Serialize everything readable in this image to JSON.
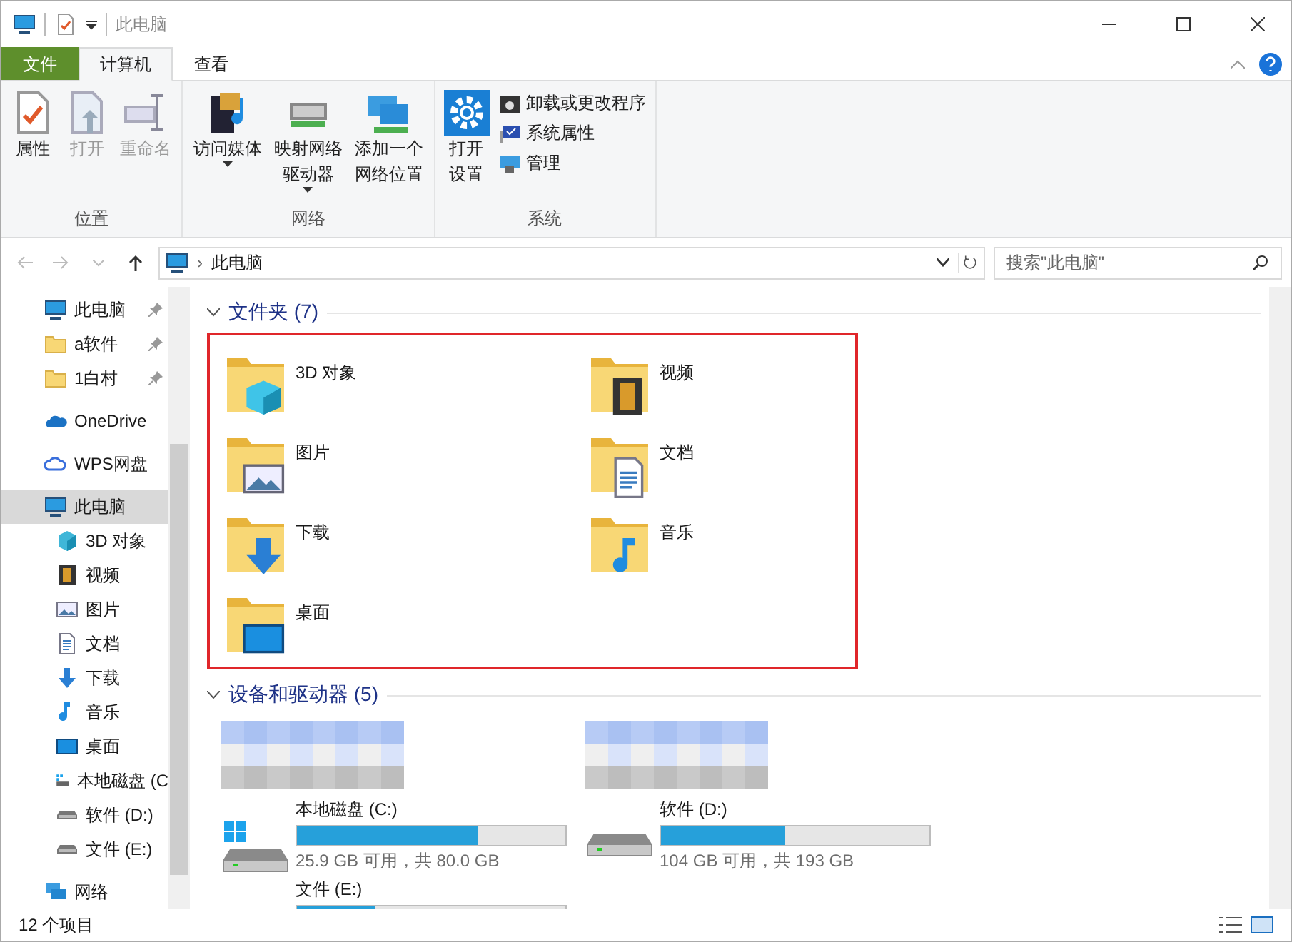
{
  "window": {
    "title": "此电脑"
  },
  "ribbon_tabs": [
    {
      "label": "文件",
      "kind": "file",
      "selected": false
    },
    {
      "label": "计算机",
      "kind": "tab",
      "selected": true
    },
    {
      "label": "查看",
      "kind": "tab",
      "selected": false
    }
  ],
  "ribbon_groups": [
    {
      "label": "位置",
      "items": [
        {
          "label": "属性",
          "disabled": false
        },
        {
          "label": "打开",
          "disabled": true
        },
        {
          "label": "重命名",
          "disabled": true
        }
      ]
    },
    {
      "label": "网络",
      "items": [
        {
          "label": "访问媒体",
          "disabled": false,
          "dropdown": true
        },
        {
          "label": "映射网络驱动器",
          "disabled": false,
          "dropdown": true
        },
        {
          "label": "添加一个网络位置",
          "disabled": false,
          "dropdown": false
        }
      ]
    },
    {
      "label": "系统",
      "items": [
        {
          "label": "打开设置",
          "disabled": false
        }
      ],
      "small_items": [
        {
          "label": "卸载或更改程序"
        },
        {
          "label": "系统属性"
        },
        {
          "label": "管理"
        }
      ]
    }
  ],
  "address": {
    "separator": "›",
    "path": "此电脑",
    "search_placeholder": "搜索\"此电脑\""
  },
  "sidebar": [
    {
      "label": "此电脑",
      "pinned": true,
      "selected": false
    },
    {
      "label": "a软件",
      "pinned": true,
      "selected": false
    },
    {
      "label": "1白村",
      "pinned": true,
      "selected": false
    },
    {
      "label": "OneDrive",
      "pinned": false,
      "selected": false
    },
    {
      "label": "WPS网盘",
      "pinned": false,
      "selected": false
    },
    {
      "label": "此电脑",
      "pinned": false,
      "selected": true,
      "children": [
        {
          "label": "3D 对象",
          "pinned": false,
          "selected": false
        },
        {
          "label": "视频",
          "pinned": false,
          "selected": false
        },
        {
          "label": "图片",
          "pinned": false,
          "selected": false
        },
        {
          "label": "文档",
          "pinned": false,
          "selected": false
        },
        {
          "label": "下载",
          "pinned": false,
          "selected": false
        },
        {
          "label": "音乐",
          "pinned": false,
          "selected": false
        },
        {
          "label": "桌面",
          "pinned": false,
          "selected": false
        },
        {
          "label": "本地磁盘 (C",
          "pinned": false,
          "selected": false
        },
        {
          "label": "软件 (D:)",
          "pinned": false,
          "selected": false
        },
        {
          "label": "文件 (E:)",
          "pinned": false,
          "selected": false
        }
      ]
    },
    {
      "label": "网络",
      "pinned": false,
      "selected": false
    }
  ],
  "folders_section": {
    "title": "文件夹 (7)",
    "expanded": true,
    "highlighted": true,
    "items": [
      {
        "label": "3D 对象"
      },
      {
        "label": "视频"
      },
      {
        "label": "图片"
      },
      {
        "label": "文档"
      },
      {
        "label": "下载"
      },
      {
        "label": "音乐"
      },
      {
        "label": "桌面"
      }
    ]
  },
  "devices_section": {
    "title": "设备和驱动器 (5)",
    "expanded": true,
    "obscured": [
      {
        "kind": "obscured"
      },
      {
        "kind": "obscured"
      }
    ],
    "drives": [
      {
        "label": "本地磁盘 (C:)",
        "level": 0.676,
        "info": "25.9 GB 可用，共 80.0 GB"
      },
      {
        "label": "软件 (D:)",
        "level": 0.461,
        "info": "104 GB 可用，共 193 GB"
      },
      {
        "label": "文件 (E:)",
        "level": 0.29
      }
    ]
  },
  "status_bar": {
    "text": "12 个项目"
  }
}
